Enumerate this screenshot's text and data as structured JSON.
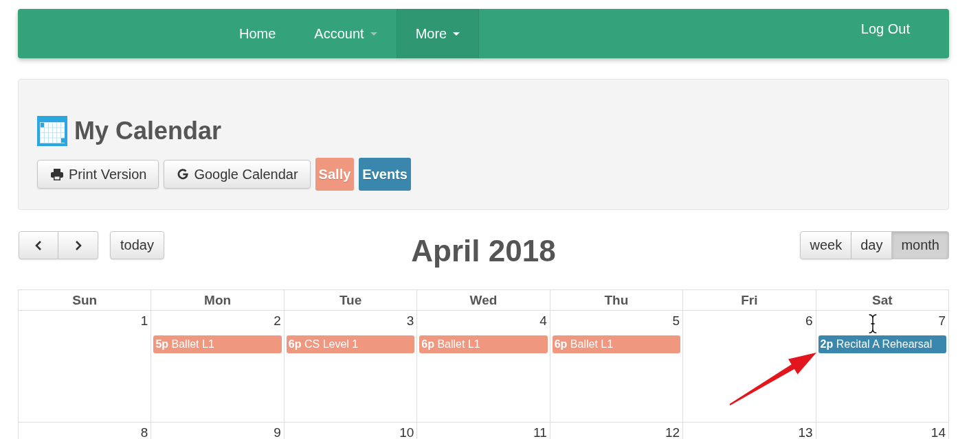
{
  "navbar": {
    "items": [
      {
        "label": "Home",
        "dropdown": false,
        "selected": false
      },
      {
        "label": "Account",
        "dropdown": true,
        "selected": false
      },
      {
        "label": "More",
        "dropdown": true,
        "selected": true
      }
    ],
    "logout": "Log Out"
  },
  "panel": {
    "title": "My Calendar",
    "buttons": [
      {
        "kind": "print",
        "label": "Print Version"
      },
      {
        "kind": "google",
        "label": "Google Calendar"
      }
    ],
    "legend": [
      {
        "label": "Sally",
        "color": "#f0977f"
      },
      {
        "label": "Events",
        "color": "#3a87ad"
      }
    ]
  },
  "toolbar": {
    "today": "today",
    "title": "April 2018",
    "views": [
      {
        "label": "week",
        "selected": false
      },
      {
        "label": "day",
        "selected": false
      },
      {
        "label": "month",
        "selected": true
      }
    ]
  },
  "calendar": {
    "weekdays": [
      "Sun",
      "Mon",
      "Tue",
      "Wed",
      "Thu",
      "Fri",
      "Sat"
    ],
    "weeks": [
      {
        "days": [
          {
            "number": "1"
          },
          {
            "number": "2",
            "events": [
              {
                "time": "5p",
                "title": "Ballet L1",
                "color": "#f0977f"
              }
            ]
          },
          {
            "number": "3",
            "events": [
              {
                "time": "6p",
                "title": "CS Level 1",
                "color": "#f0977f"
              }
            ]
          },
          {
            "number": "4",
            "events": [
              {
                "time": "6p",
                "title": "Ballet L1",
                "color": "#f0977f"
              }
            ]
          },
          {
            "number": "5",
            "events": [
              {
                "time": "6p",
                "title": "Ballet L1",
                "color": "#f0977f"
              }
            ]
          },
          {
            "number": "6"
          },
          {
            "number": "7",
            "events": [
              {
                "time": "2p",
                "title": "Recital A Rehearsal",
                "color": "#3a87ad"
              }
            ]
          }
        ]
      },
      {
        "days": [
          {
            "number": "8"
          },
          {
            "number": "9"
          },
          {
            "number": "10"
          },
          {
            "number": "11"
          },
          {
            "number": "12"
          },
          {
            "number": "13"
          },
          {
            "number": "14"
          }
        ]
      }
    ]
  }
}
